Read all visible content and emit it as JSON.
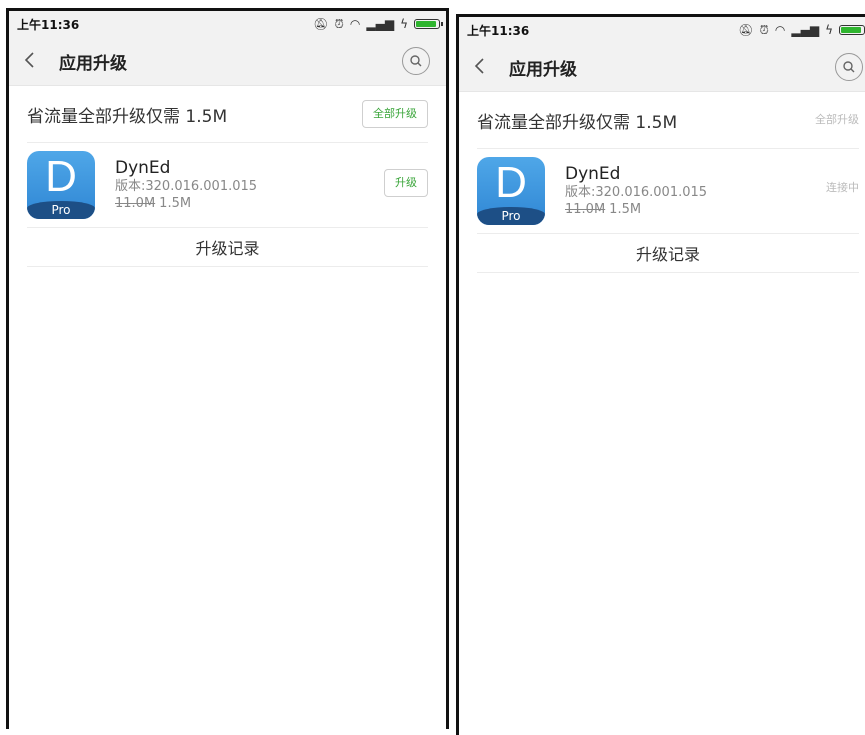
{
  "screens": [
    {
      "status": {
        "time": "上午11:36"
      },
      "header": {
        "back_label": "<",
        "title": "应用升级"
      },
      "summary": {
        "text": "省流量全部升级仅需 1.5M",
        "button_label": "全部升级"
      },
      "app": {
        "icon_letter": "D",
        "icon_badge": "Pro",
        "name": "DynEd",
        "version": "版本:320.016.001.015",
        "old_size": "11.0M",
        "new_size": "1.5M",
        "action_label": "升级"
      },
      "history_label": "升级记录"
    },
    {
      "status": {
        "time": "上午11:36"
      },
      "header": {
        "back_label": "<",
        "title": "应用升级"
      },
      "summary": {
        "text": "省流量全部升级仅需 1.5M",
        "button_label": "全部升级"
      },
      "app": {
        "icon_letter": "D",
        "icon_badge": "Pro",
        "name": "DynEd",
        "version": "版本:320.016.001.015",
        "old_size": "11.0M",
        "new_size": "1.5M",
        "action_label": "连接中"
      },
      "history_label": "升级记录"
    }
  ],
  "colors": {
    "accent_green": "#3aa53a",
    "disabled_gray": "#bbbbbb",
    "icon_blue": "#2f86d4"
  }
}
